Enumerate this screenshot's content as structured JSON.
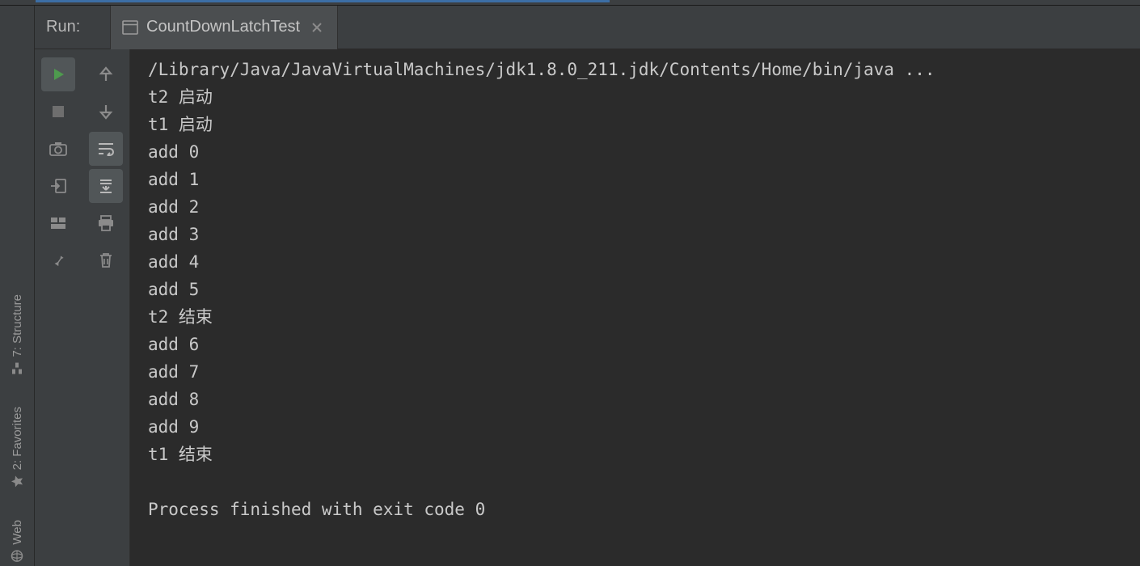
{
  "tabbar": {
    "run_label": "Run:",
    "tab_title": "CountDownLatchTest"
  },
  "left_rail": {
    "structure": "7: Structure",
    "favorites": "2: Favorites",
    "web": "Web"
  },
  "icons": {
    "run": "run-icon",
    "stop": "stop-icon",
    "camera": "camera-icon",
    "export": "export-icon",
    "layout": "layout-icon",
    "pin": "pin-icon",
    "up": "up-icon",
    "down": "down-icon",
    "wrap": "wrap-icon",
    "scroll_end": "scroll-end-icon",
    "print": "print-icon",
    "trash": "trash-icon",
    "application": "application-icon",
    "close": "close-icon",
    "structure_icon": "structure-panel-icon",
    "star": "star-icon",
    "globe": "globe-icon"
  },
  "console": {
    "lines": [
      "/Library/Java/JavaVirtualMachines/jdk1.8.0_211.jdk/Contents/Home/bin/java ...",
      "t2 启动",
      "t1 启动",
      "add 0",
      "add 1",
      "add 2",
      "add 3",
      "add 4",
      "add 5",
      "t2 结束",
      "add 6",
      "add 7",
      "add 8",
      "add 9",
      "t1 结束",
      "",
      "Process finished with exit code 0"
    ]
  }
}
